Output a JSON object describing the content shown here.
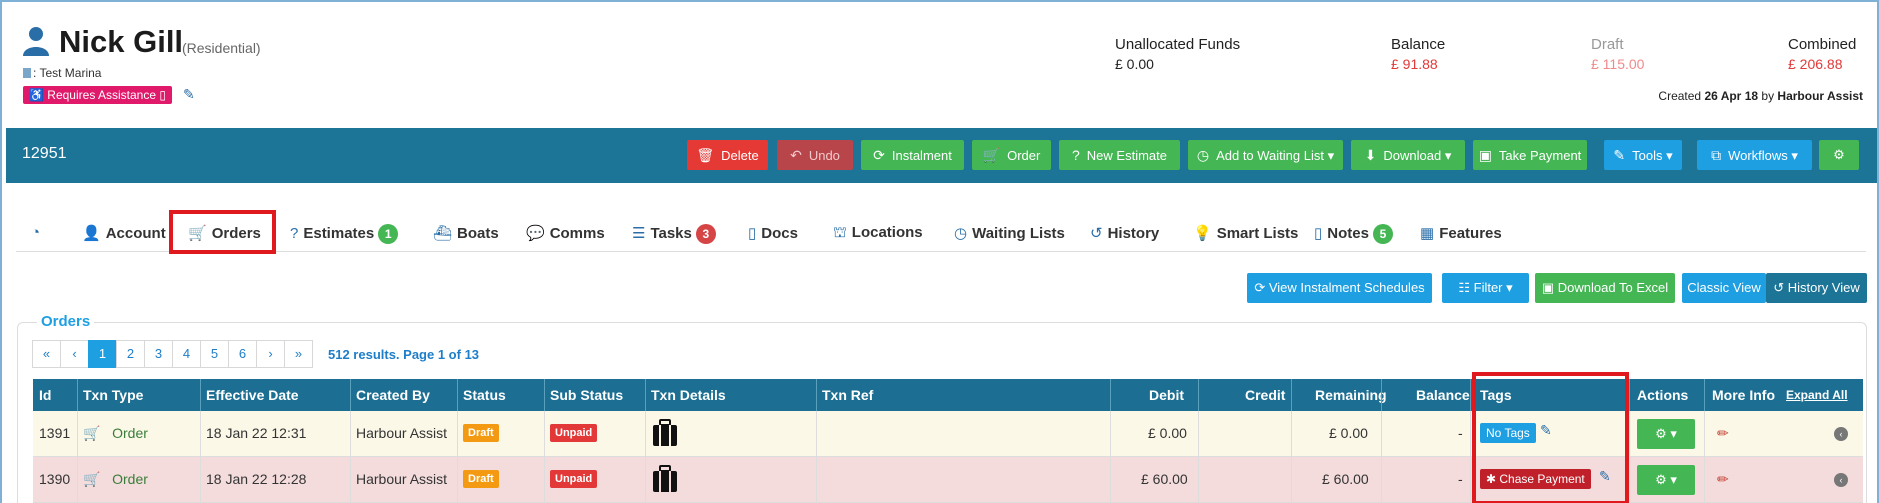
{
  "customer": {
    "name": "Nick Gill",
    "type": "(Residential)",
    "marina": ": Test Marina",
    "assist_badge": "Requires Assistance",
    "created_prefix": "Created",
    "created_date": "26 Apr 18",
    "created_by_prefix": "by",
    "created_by": "Harbour Assist"
  },
  "funds": [
    {
      "label": "Unallocated Funds",
      "value": "£ 0.00",
      "color": "#222222"
    },
    {
      "label": "Balance",
      "value": "£ 91.88",
      "color": "#e23838"
    },
    {
      "label": "Draft",
      "value": "£ 115.00",
      "color": "#f08a8a"
    },
    {
      "label": "Combined",
      "value": "£ 206.88",
      "color": "#e23838"
    }
  ],
  "toolbar": {
    "record_id": "12951",
    "delete": "Delete",
    "undo": "Undo",
    "instalment": "Instalment",
    "order": "Order",
    "new_estimate": "New Estimate",
    "waiting_list": "Add to Waiting List ▾",
    "download": "Download ▾",
    "take_payment": "Take Payment",
    "tools": "Tools ▾",
    "workflows": "Workflows ▾"
  },
  "tabs": {
    "account": "Account",
    "orders": "Orders",
    "estimates": "Estimates",
    "estimates_count": "1",
    "boats": "Boats",
    "comms": "Comms",
    "tasks": "Tasks",
    "tasks_count": "3",
    "docs": "Docs",
    "locations": "Locations",
    "waiting_lists": "Waiting Lists",
    "history": "History",
    "smart_lists": "Smart Lists",
    "notes": "Notes",
    "notes_count": "5",
    "features": "Features"
  },
  "actions": {
    "view_schedules": "View Instalment Schedules",
    "filter": "Filter ▾",
    "download_excel": "Download To Excel",
    "classic_view": "Classic View",
    "history_view": "History View"
  },
  "orders": {
    "title": "Orders",
    "pager": [
      "«",
      "‹",
      "1",
      "2",
      "3",
      "4",
      "5",
      "6",
      "›",
      "»"
    ],
    "results": "512 results. Page 1 of 13",
    "columns": {
      "id": "Id",
      "txn_type": "Txn Type",
      "effective_date": "Effective Date",
      "created_by": "Created By",
      "status": "Status",
      "sub_status": "Sub Status",
      "txn_details": "Txn Details",
      "txn_ref": "Txn Ref",
      "debit": "Debit",
      "credit": "Credit",
      "remaining": "Remaining",
      "balance": "Balance",
      "tags": "Tags",
      "actions": "Actions",
      "more_info": "More Info",
      "expand_all": "Expand All"
    },
    "rows": [
      {
        "id": "1391",
        "type": "Order",
        "date": "18 Jan 22 12:31",
        "created_by": "Harbour Assist",
        "status": "Draft",
        "sub_status": "Unpaid",
        "txn_ref": "",
        "debit": "£ 0.00",
        "credit": "",
        "remaining": "£ 0.00",
        "balance": "-",
        "tag": "No Tags"
      },
      {
        "id": "1390",
        "type": "Order",
        "date": "18 Jan 22 12:28",
        "created_by": "Harbour Assist",
        "status": "Draft",
        "sub_status": "Unpaid",
        "txn_ref": "",
        "debit": "£ 60.00",
        "credit": "",
        "remaining": "£ 60.00",
        "balance": "-",
        "tag": "Chase Payment"
      }
    ]
  }
}
